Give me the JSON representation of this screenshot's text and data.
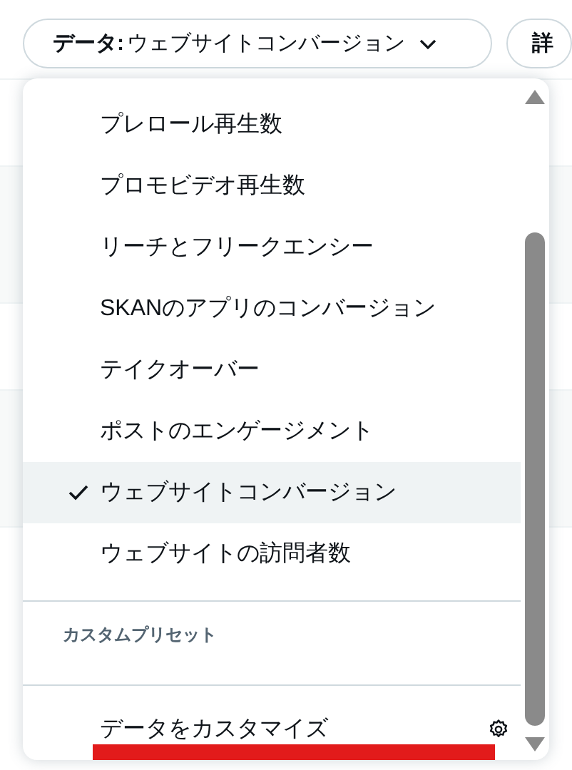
{
  "filter_bar": {
    "data_button": {
      "label": "データ:",
      "value": "ウェブサイトコンバージョン"
    },
    "right_button": "詳"
  },
  "menu": {
    "items": [
      {
        "label": "プレロール再生数",
        "selected": false
      },
      {
        "label": "プロモビデオ再生数",
        "selected": false
      },
      {
        "label": "リーチとフリークエンシー",
        "selected": false
      },
      {
        "label": "SKANのアプリのコンバージョン",
        "selected": false
      },
      {
        "label": "テイクオーバー",
        "selected": false
      },
      {
        "label": "ポストのエンゲージメント",
        "selected": false
      },
      {
        "label": "ウェブサイトコンバージョン",
        "selected": true
      },
      {
        "label": "ウェブサイトの訪問者数",
        "selected": false
      }
    ],
    "section_header": "カスタムプリセット",
    "footer_item": {
      "label": "データをカスタマイズ"
    }
  },
  "annotation": {
    "kind": "underline"
  }
}
